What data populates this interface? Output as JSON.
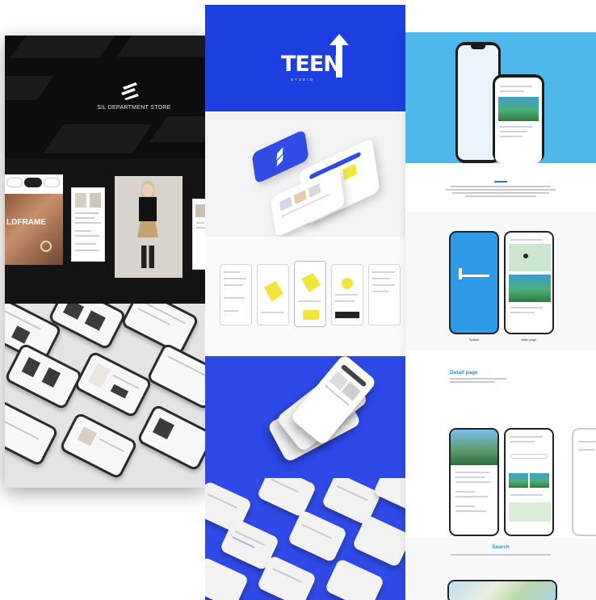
{
  "portfolio": {
    "store": {
      "title": "SIL DEPARTMENT STORE",
      "tabs": [
        "",
        "",
        ""
      ],
      "banner_text": "LDFRAME"
    },
    "teen": {
      "logo_word": "TEEN",
      "logo_sub": "STUDIO"
    },
    "travel": {
      "splash_caption": "Splash",
      "main_caption": "Main page",
      "detail_title": "Detail page",
      "search_title": "Search"
    }
  },
  "colors": {
    "teen_blue": "#1d3fe0",
    "travel_sky": "#4fb8ea",
    "travel_accent": "#2f8fd8",
    "store_black": "#0b0b0b"
  },
  "icons": [
    "sil-logo-icon",
    "teen-arrow-icon"
  ]
}
